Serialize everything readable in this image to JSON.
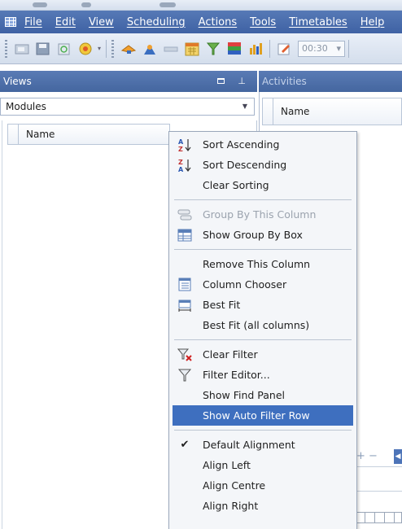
{
  "menubar": {
    "items": [
      "File",
      "Edit",
      "View",
      "Scheduling",
      "Actions",
      "Tools",
      "Timetables",
      "Help"
    ]
  },
  "toolbar": {
    "time_value": "00:30"
  },
  "views_pane": {
    "title": "Views",
    "selected_view": "Modules",
    "column_header": "Name"
  },
  "activities_pane": {
    "title": "Activities",
    "column_header": "Name"
  },
  "context_menu": {
    "sort_ascending": "Sort Ascending",
    "sort_descending": "Sort Descending",
    "clear_sorting": "Clear Sorting",
    "group_by_column": "Group By This Column",
    "show_group_by_box": "Show Group By Box",
    "remove_column": "Remove This Column",
    "column_chooser": "Column Chooser",
    "best_fit": "Best Fit",
    "best_fit_all": "Best Fit (all columns)",
    "clear_filter": "Clear Filter",
    "filter_editor": "Filter Editor...",
    "show_find_panel": "Show Find Panel",
    "show_auto_filter_row": "Show Auto Filter Row",
    "default_alignment": "Default Alignment",
    "align_left": "Align Left",
    "align_centre": "Align Centre",
    "align_right": "Align Right",
    "checkmark": "✔"
  },
  "colors": {
    "menubar": "#4a6dad",
    "highlight": "#3e6fbf",
    "pane_header": "#5070ad"
  }
}
